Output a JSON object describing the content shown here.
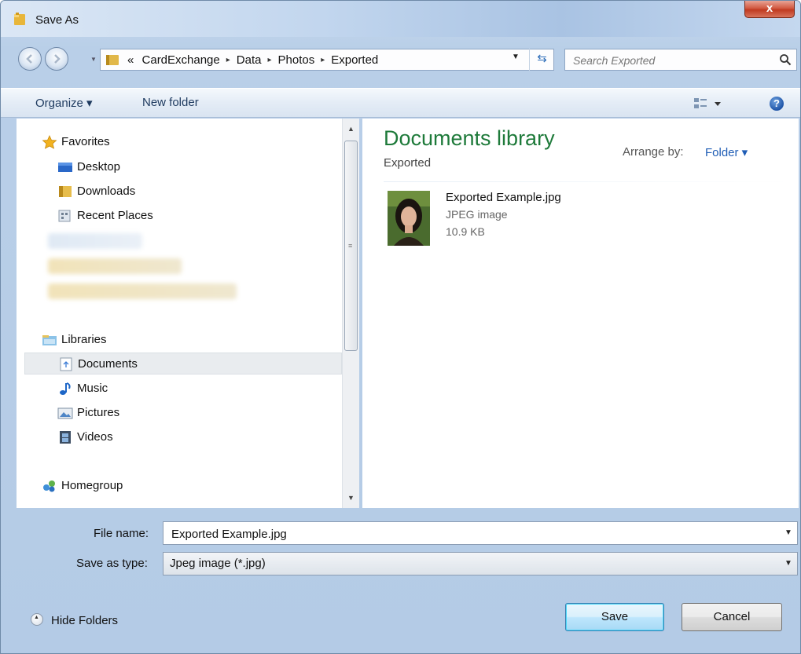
{
  "window": {
    "title": "Save As",
    "close_label": "x"
  },
  "address": {
    "overflow_marker": "«",
    "crumbs": [
      "CardExchange",
      "Data",
      "Photos",
      "Exported"
    ],
    "separator": "▸"
  },
  "search": {
    "placeholder": "Search Exported"
  },
  "toolbar": {
    "organize_label": "Organize ▾",
    "new_folder_label": "New folder",
    "help_label": "?"
  },
  "navpane": {
    "favorites_label": "Favorites",
    "favorites": [
      {
        "label": "Desktop",
        "icon": "desktop-icon"
      },
      {
        "label": "Downloads",
        "icon": "folder-icon"
      },
      {
        "label": "Recent Places",
        "icon": "recent-places-icon"
      }
    ],
    "libraries_label": "Libraries",
    "libraries": [
      {
        "label": "Documents",
        "icon": "documents-icon",
        "selected": true
      },
      {
        "label": "Music",
        "icon": "music-icon"
      },
      {
        "label": "Pictures",
        "icon": "pictures-icon"
      },
      {
        "label": "Videos",
        "icon": "videos-icon"
      }
    ],
    "homegroup_label": "Homegroup"
  },
  "content": {
    "library_title": "Documents library",
    "library_subtitle": "Exported",
    "arrange_label": "Arrange by:",
    "arrange_value": "Folder ▾",
    "files": [
      {
        "name": "Exported Example.jpg",
        "type": "JPEG image",
        "size": "10.9 KB"
      }
    ]
  },
  "form": {
    "file_name_label": "File name:",
    "file_name_value": "Exported Example.jpg",
    "save_type_label": "Save as type:",
    "save_type_value": "Jpeg image (*.jpg)"
  },
  "footer": {
    "hide_folders_label": "Hide Folders",
    "save_label": "Save",
    "cancel_label": "Cancel"
  },
  "colors": {
    "library_title": "#1e7a3a",
    "link_blue": "#1f5db5",
    "close_red": "#c03a20"
  }
}
